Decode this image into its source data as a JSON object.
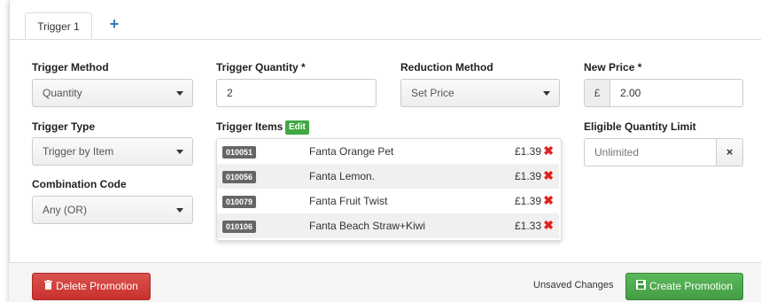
{
  "tabs": {
    "active_label": "Trigger 1",
    "add_label": "+"
  },
  "form": {
    "trigger_method": {
      "label": "Trigger Method",
      "value": "Quantity"
    },
    "trigger_quantity": {
      "label": "Trigger Quantity *",
      "value": "2"
    },
    "reduction_method": {
      "label": "Reduction Method",
      "value": "Set Price"
    },
    "new_price": {
      "label": "New Price *",
      "currency": "£",
      "value": "2.00"
    },
    "trigger_type": {
      "label": "Trigger Type",
      "value": "Trigger by Item"
    },
    "trigger_items": {
      "label": "Trigger Items",
      "edit_label": "Edit"
    },
    "eligible_quantity_limit": {
      "label": "Eligible Quantity Limit",
      "placeholder": "Unlimited",
      "clear_label": "×"
    },
    "combination_code": {
      "label": "Combination Code",
      "value": "Any (OR)"
    }
  },
  "items": [
    {
      "code": "010051",
      "name": "Fanta Orange Pet",
      "price": "£1.39",
      "remove": "✖"
    },
    {
      "code": "010056",
      "name": "Fanta Lemon.",
      "price": "£1.39",
      "remove": "✖"
    },
    {
      "code": "010079",
      "name": "Fanta Fruit Twist",
      "price": "£1.39",
      "remove": "✖"
    },
    {
      "code": "010106",
      "name": "Fanta Beach Straw+Kiwi",
      "price": "£1.33",
      "remove": "✖"
    }
  ],
  "footer": {
    "delete_label": "Delete Promotion",
    "unsaved_text": "Unsaved Changes",
    "create_label": "Create Promotion"
  },
  "colors": {
    "danger": "#d9534f",
    "success": "#5cb85c",
    "accent": "#337ab7",
    "remove": "#e02020"
  }
}
